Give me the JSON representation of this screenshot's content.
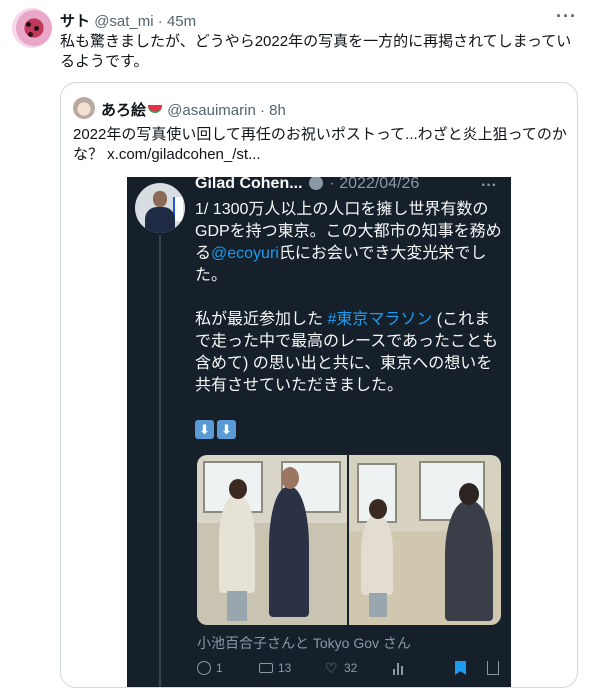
{
  "tweet": {
    "author_name": "サト",
    "author_handle": "@sat_mi",
    "separator": "·",
    "time": "45m",
    "text": "私も驚きましたが、どうやら2022年の写真を一方的に再掲されてしまっているようです。"
  },
  "quoted": {
    "author_name": "あろ絵",
    "author_handle": "@asauimarin",
    "separator": "·",
    "time": "8h",
    "text": "2022年の写真使い回して再任のお祝いポストって...わざと炎上狙ってのかな？ x.com/giladcohen_/st..."
  },
  "screenshot": {
    "author_name": "Gilad Cohen...",
    "date": "· 2022/04/26",
    "paragraph1_before": "1/  1300万人以上の人口を擁し世界有数のGDPを持つ東京。この大都市の知事を務める",
    "paragraph1_link": "@ecoyuri",
    "paragraph1_after": "氏にお会いでき大変光栄でした。",
    "paragraph2_before": "私が最近参加した ",
    "paragraph2_link": "#東京マラソン",
    "paragraph2_after": " (これまで走った中で最高のレースであったことも含めて) の思い出と共に、東京への想いを共有させていただきました。",
    "arrow_glyph": "⬇",
    "caption": "小池百合子さんと Tokyo Gov さん",
    "reply_count": "1",
    "retweet_count": "13",
    "like_count": "32"
  },
  "colors": {
    "accent": "#1d9bf0",
    "dark_bg": "#15202b",
    "muted": "#536471"
  },
  "icons": [
    "more-icon",
    "verified-icon",
    "reply-icon",
    "retweet-icon",
    "like-icon",
    "stats-icon",
    "bookmark-icon",
    "share-icon",
    "watermelon-emoji-icon",
    "down-arrow-emoji-icon"
  ]
}
